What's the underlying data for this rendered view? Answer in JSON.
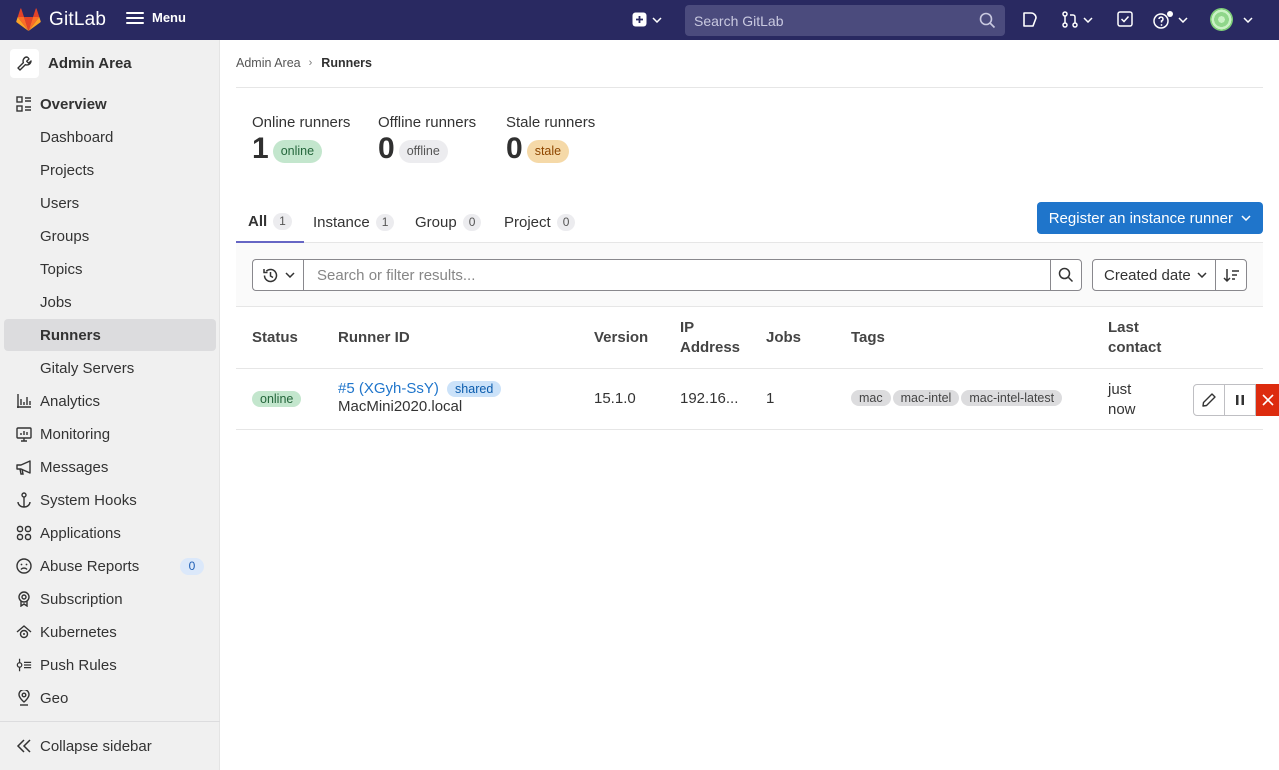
{
  "navbar": {
    "brand": "GitLab",
    "menu_label": "Menu",
    "search_placeholder": "Search GitLab"
  },
  "sidebar": {
    "context_title": "Admin Area",
    "items": [
      {
        "label": "Overview",
        "icon": "overview-icon"
      },
      {
        "label": "Dashboard"
      },
      {
        "label": "Projects"
      },
      {
        "label": "Users"
      },
      {
        "label": "Groups"
      },
      {
        "label": "Topics"
      },
      {
        "label": "Jobs"
      },
      {
        "label": "Runners",
        "active": true
      },
      {
        "label": "Gitaly Servers"
      },
      {
        "label": "Analytics",
        "icon": "analytics-icon"
      },
      {
        "label": "Monitoring",
        "icon": "monitor-icon"
      },
      {
        "label": "Messages",
        "icon": "megaphone-icon"
      },
      {
        "label": "System Hooks",
        "icon": "anchor-icon"
      },
      {
        "label": "Applications",
        "icon": "applications-icon"
      },
      {
        "label": "Abuse Reports",
        "icon": "slight-frown-icon",
        "badge": "0"
      },
      {
        "label": "Subscription",
        "icon": "licence-icon"
      },
      {
        "label": "Kubernetes",
        "icon": "cloud-gear-icon"
      },
      {
        "label": "Push Rules",
        "icon": "push-rules-icon"
      },
      {
        "label": "Geo",
        "icon": "location-icon"
      }
    ],
    "collapse_label": "Collapse sidebar"
  },
  "breadcrumb": {
    "parent": "Admin Area",
    "current": "Runners"
  },
  "stats": [
    {
      "label": "Online runners",
      "value": "1",
      "badge": "online"
    },
    {
      "label": "Offline runners",
      "value": "0",
      "badge": "offline"
    },
    {
      "label": "Stale runners",
      "value": "0",
      "badge": "stale"
    }
  ],
  "tabs": [
    {
      "label": "All",
      "count": "1",
      "active": true
    },
    {
      "label": "Instance",
      "count": "1"
    },
    {
      "label": "Group",
      "count": "0"
    },
    {
      "label": "Project",
      "count": "0"
    }
  ],
  "register_button": "Register an instance runner",
  "filter": {
    "placeholder": "Search or filter results...",
    "sort_label": "Created date"
  },
  "table": {
    "headers": {
      "status": "Status",
      "runner_id": "Runner ID",
      "version": "Version",
      "ip_line1": "IP",
      "ip_line2": "Address",
      "jobs": "Jobs",
      "tags": "Tags",
      "last_contact_line1": "Last",
      "last_contact_line2": "contact"
    },
    "rows": [
      {
        "status": "online",
        "runner_link": "#5 (XGyh-SsY)",
        "type_badge": "shared",
        "description": "MacMini2020.local",
        "version": "15.1.0",
        "ip": "192.16...",
        "jobs": "1",
        "tags": [
          "mac",
          "mac-intel",
          "mac-intel-latest"
        ],
        "last_contact_line1": "just",
        "last_contact_line2": "now"
      }
    ]
  }
}
